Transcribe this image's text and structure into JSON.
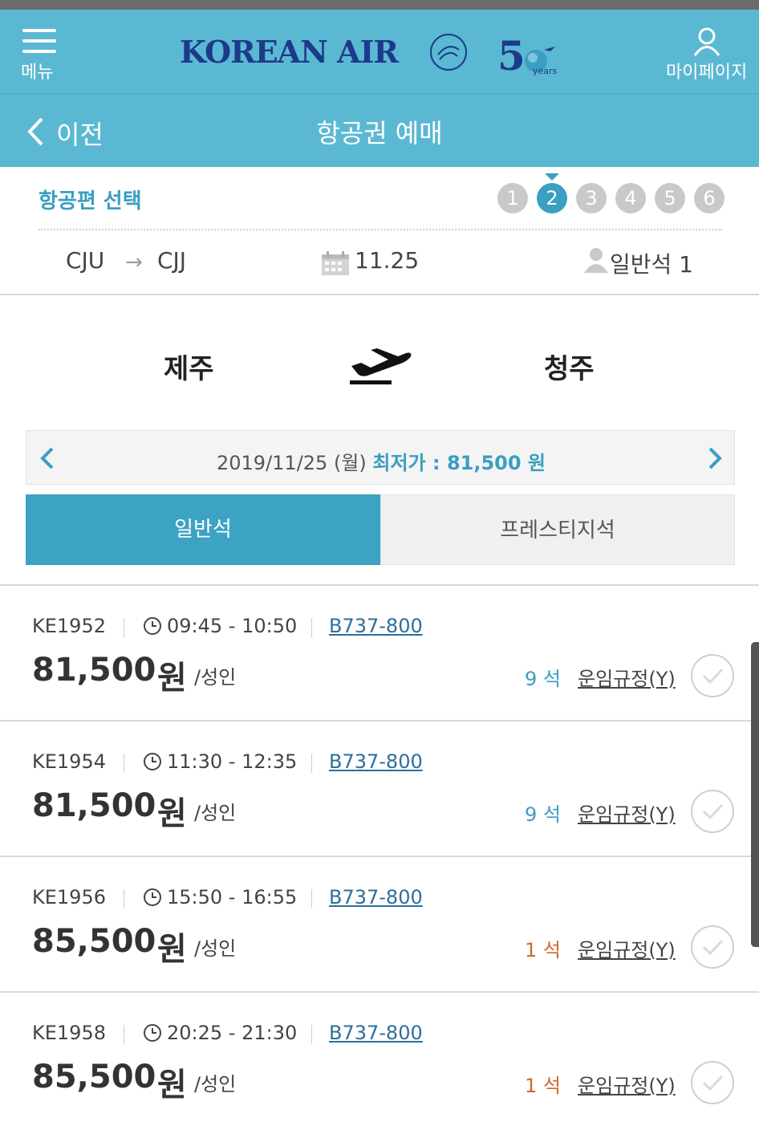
{
  "header": {
    "menu_label": "메뉴",
    "logo_text": "KOREAN AIR",
    "logo_fifty": "5",
    "logo_years": "years",
    "mypage_label": "마이페이지"
  },
  "subheader": {
    "back_label": "이전",
    "title": "항공권 예매"
  },
  "step_section": {
    "title": "항공편 선택",
    "steps": [
      "1",
      "2",
      "3",
      "4",
      "5",
      "6"
    ],
    "active_step": 2,
    "route_from": "CJU",
    "route_to": "CJJ",
    "date": "11.25",
    "passengers": "일반석 1"
  },
  "cities": {
    "from": "제주",
    "to": "청주"
  },
  "datebar": {
    "date": "2019/11/25 (월)",
    "lowest_label": "최저가 : 81,500 원"
  },
  "tabs": {
    "economy": "일반석",
    "prestige": "프레스티지석"
  },
  "flights": [
    {
      "flight_no": "KE1952",
      "time": "09:45 - 10:50",
      "aircraft": "B737-800",
      "price": "81,500",
      "unit": "원",
      "per": "/성인",
      "seats": "9 석",
      "seat_color": "blue",
      "fare_rule": "운임규정(Y)"
    },
    {
      "flight_no": "KE1954",
      "time": "11:30 - 12:35",
      "aircraft": "B737-800",
      "price": "81,500",
      "unit": "원",
      "per": "/성인",
      "seats": "9 석",
      "seat_color": "blue",
      "fare_rule": "운임규정(Y)"
    },
    {
      "flight_no": "KE1956",
      "time": "15:50 - 16:55",
      "aircraft": "B737-800",
      "price": "85,500",
      "unit": "원",
      "per": "/성인",
      "seats": "1 석",
      "seat_color": "orange",
      "fare_rule": "운임규정(Y)"
    },
    {
      "flight_no": "KE1958",
      "time": "20:25 - 21:30",
      "aircraft": "B737-800",
      "price": "85,500",
      "unit": "원",
      "per": "/성인",
      "seats": "1 석",
      "seat_color": "orange",
      "fare_rule": "운임규정(Y)"
    }
  ],
  "colors": {
    "header_bg": "#5bb8d3",
    "accent": "#3a9fc0",
    "seats_low": "#d0682a",
    "logo_blue": "#1d3a8a"
  }
}
